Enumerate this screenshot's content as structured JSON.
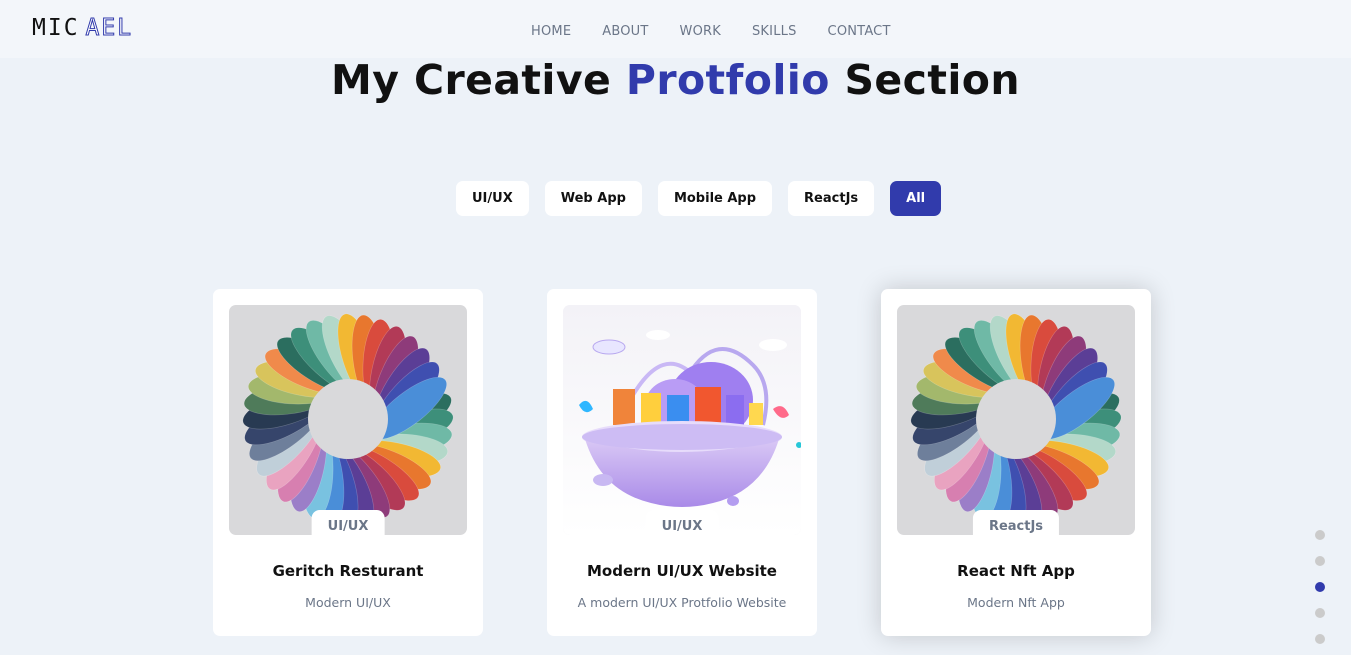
{
  "logo": {
    "part1": "MIC",
    "part2": "AEL"
  },
  "nav": [
    "HOME",
    "ABOUT",
    "WORK",
    "SKILLS",
    "CONTACT"
  ],
  "title": {
    "part1": "My Creative ",
    "accent": "Protfolio",
    "part2": " Section"
  },
  "filters": [
    {
      "label": "UI/UX",
      "active": false
    },
    {
      "label": "Web App",
      "active": false
    },
    {
      "label": "Mobile App",
      "active": false
    },
    {
      "label": "ReactJs",
      "active": false
    },
    {
      "label": "All",
      "active": true
    }
  ],
  "cards": [
    {
      "tag": "UI/UX",
      "title": "Geritch Resturant",
      "description": "Modern UI/UX"
    },
    {
      "tag": "UI/UX",
      "title": "Modern UI/UX Website",
      "description": "A modern UI/UX Protfolio Website"
    },
    {
      "tag": "ReactJs",
      "title": "React Nft App",
      "description": "Modern Nft App"
    }
  ],
  "dots": {
    "count": 5,
    "active_index": 2
  },
  "colors": {
    "accent": "#313bac",
    "background": "#edf2f8",
    "muted_text": "#6b7688"
  }
}
